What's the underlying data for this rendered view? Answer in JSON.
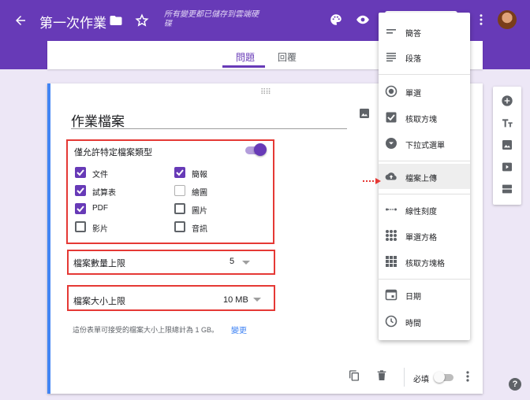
{
  "header": {
    "title": "第一次作業",
    "saved_note": "所有變更都已儲存到雲端硬碟"
  },
  "tabs": [
    {
      "label": "問題"
    },
    {
      "label": "回覆"
    }
  ],
  "question": {
    "title": "作業檔案",
    "filetype_label": "僅允許特定檔案類型",
    "filetypes": [
      {
        "label": "文件",
        "checked": true
      },
      {
        "label": "簡報",
        "checked": true
      },
      {
        "label": "試算表",
        "checked": true
      },
      {
        "label": "繪圖",
        "checked": false
      },
      {
        "label": "PDF",
        "checked": true
      },
      {
        "label": "圖片",
        "checked": false
      },
      {
        "label": "影片",
        "checked": false
      },
      {
        "label": "音訊",
        "checked": false
      }
    ],
    "max_files_label": "檔案數量上限",
    "max_files_value": "5",
    "max_size_label": "檔案大小上限",
    "max_size_value": "10 MB",
    "limit_note": "這份表單可接受的檔案大小上限總計為 1 GB。",
    "change_link": "變更",
    "required_label": "必填"
  },
  "type_menu": {
    "items": [
      {
        "label": "簡答",
        "icon": "short-answer-icon"
      },
      {
        "label": "段落",
        "icon": "paragraph-icon"
      },
      {
        "label": "單選",
        "icon": "radio-icon"
      },
      {
        "label": "核取方塊",
        "icon": "checkbox-icon"
      },
      {
        "label": "下拉式選單",
        "icon": "dropdown-icon"
      },
      {
        "label": "檔案上傳",
        "icon": "upload-cloud-icon",
        "selected": true
      },
      {
        "label": "線性刻度",
        "icon": "linear-scale-icon"
      },
      {
        "label": "單選方格",
        "icon": "grid-icon"
      },
      {
        "label": "核取方塊格",
        "icon": "checkbox-grid-icon"
      },
      {
        "label": "日期",
        "icon": "calendar-icon"
      },
      {
        "label": "時間",
        "icon": "clock-icon"
      }
    ]
  },
  "colors": {
    "brand_purple": "#673ab7",
    "background": "#ede7f6",
    "highlight_red": "#e53935",
    "link_blue": "#4285f4"
  }
}
